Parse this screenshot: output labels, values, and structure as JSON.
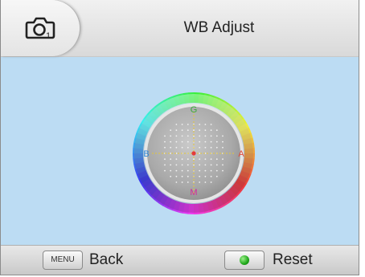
{
  "header": {
    "icon": "camera-icon",
    "title": "WB Adjust"
  },
  "dial": {
    "labels": {
      "top": "G",
      "bottom": "M",
      "left": "B",
      "right": "A"
    },
    "colors": {
      "G": "#3aa83a",
      "M": "#d12c9b",
      "B": "#2b86d9",
      "A": "#e44a3a"
    }
  },
  "footer": {
    "menu_key": "MENU",
    "back_label": "Back",
    "reset_label": "Reset"
  }
}
